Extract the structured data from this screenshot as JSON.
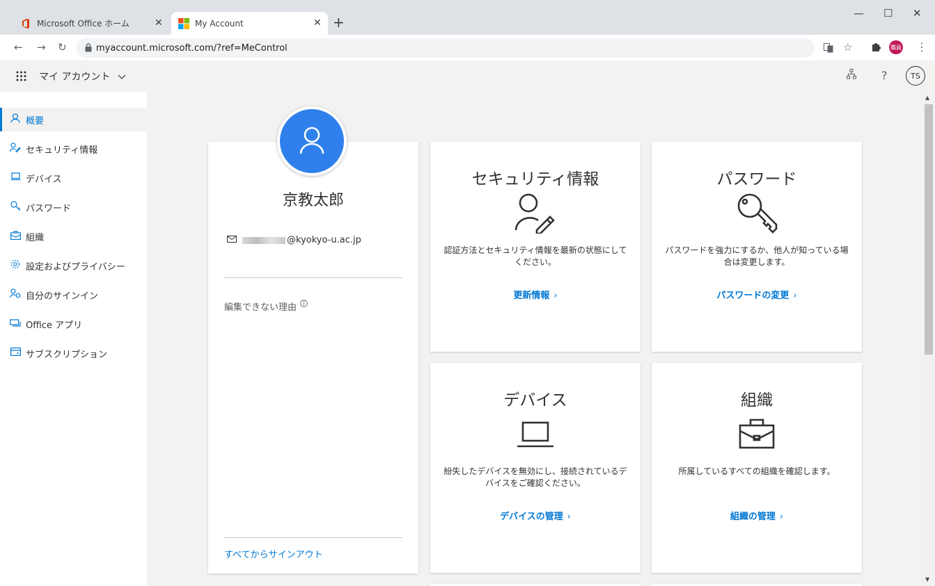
{
  "browser": {
    "tabs": [
      {
        "title": "Microsoft Office ホーム",
        "close": "✕"
      },
      {
        "title": "My Account",
        "close": "✕"
      }
    ],
    "new_tab": "+",
    "window_controls": {
      "minimize": "—",
      "maximize": "☐",
      "close": "✕"
    },
    "url": "myaccount.microsoft.com/?ref=MeControl",
    "profile_badge": "職員"
  },
  "header": {
    "app_name": "マイ アカウント",
    "help": "?",
    "user_initials": "TS"
  },
  "sidebar": {
    "items": [
      {
        "label": "概要",
        "icon": "person-icon"
      },
      {
        "label": "セキュリティ情報",
        "icon": "security-info-icon"
      },
      {
        "label": "デバイス",
        "icon": "laptop-icon"
      },
      {
        "label": "パスワード",
        "icon": "key-icon"
      },
      {
        "label": "組織",
        "icon": "briefcase-icon"
      },
      {
        "label": "設定およびプライバシー",
        "icon": "gear-icon"
      },
      {
        "label": "自分のサインイン",
        "icon": "sign-in-icon"
      },
      {
        "label": "Office アプリ",
        "icon": "office-apps-icon"
      },
      {
        "label": "サブスクリプション",
        "icon": "subscription-icon"
      }
    ]
  },
  "profile": {
    "name": "京教太郎",
    "email_domain": "@kyokyo-u.ac.jp",
    "cannot_edit_label": "編集できない理由",
    "sign_out_all": "すべてからサインアウト"
  },
  "tiles": {
    "security": {
      "title": "セキュリティ情報",
      "description": "認証方法とセキュリティ情報を最新の状態にしてください。",
      "link": "更新情報",
      "chevron": "›"
    },
    "password": {
      "title": "パスワード",
      "description": "パスワードを強力にするか、他人が知っている場合は変更します。",
      "link": "パスワードの変更",
      "chevron": "›"
    },
    "devices": {
      "title": "デバイス",
      "description": "紛失したデバイスを無効にし、接続されているデバイスをご確認ください。",
      "link": "デバイスの管理",
      "chevron": "›"
    },
    "organizations": {
      "title": "組織",
      "description": "所属しているすべての組織を確認します。",
      "link": "組織の管理",
      "chevron": "›"
    }
  },
  "colors": {
    "accent": "#0078d4",
    "avatar_bg": "#2f80ed",
    "page_bg": "#f3f2f1"
  }
}
